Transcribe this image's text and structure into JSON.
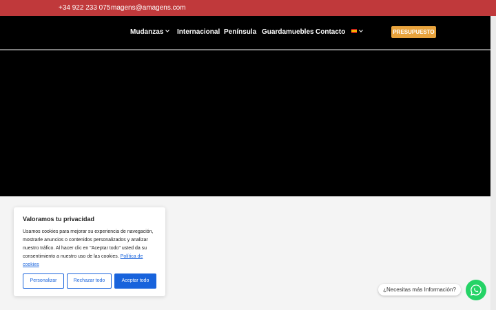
{
  "topbar": {
    "phone": "+34 922 233 075",
    "email": "magens@amagens.com"
  },
  "nav": {
    "items": [
      {
        "label": "Mudanzas",
        "has_dropdown": true
      },
      {
        "label": "Internacional"
      },
      {
        "label": "Península"
      },
      {
        "label": "Guardamuebles"
      },
      {
        "label": "Contacto"
      }
    ],
    "language": "es",
    "cta_label": "PRESUPUESTO"
  },
  "cookie": {
    "title": "Valoramos tu privacidad",
    "body": "Usamos cookies para mejorar su experiencia de navegación, mostrarle anuncios o contenidos personalizados y analizar nuestro tráfico. Al hacer clic en \"Aceptar todo\" usted da su consentimiento a nuestro uso de las cookies.",
    "policy_link": "Política de cookies",
    "customize": "Personalizar",
    "reject": "Rechazar todo",
    "accept": "Aceptar todo"
  },
  "whatsapp": {
    "prompt": "¿Necesitas más Información?"
  },
  "colors": {
    "topbar": "#c0393b",
    "header": "#000000",
    "cta": "#e8a33d",
    "cookie_accent": "#1863dc",
    "whatsapp": "#25d366"
  }
}
